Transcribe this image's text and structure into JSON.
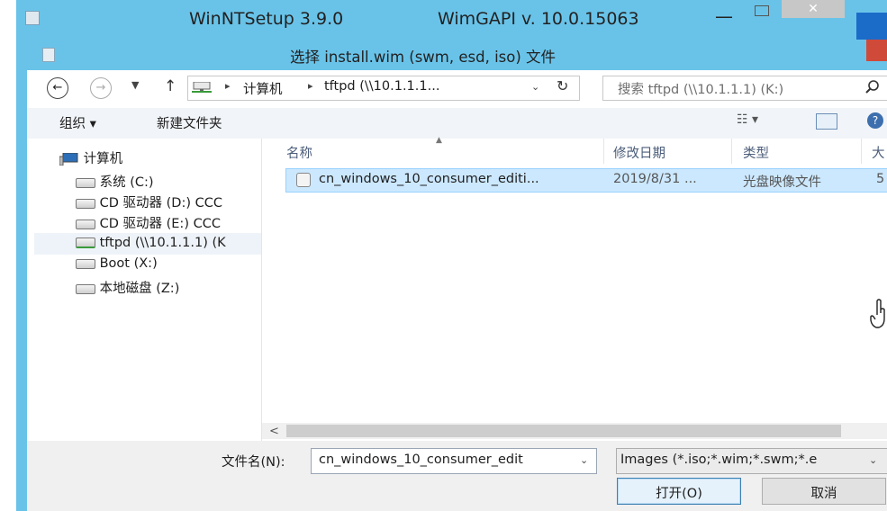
{
  "outer_window": {
    "title": "WinNTSetup 3.9.0",
    "gapi": "WimGAPI v. 10.0.15063",
    "minimize_glyph": "—",
    "close_glyph": "✕"
  },
  "dialog": {
    "title": "选择 install.wim (swm, esd, iso) 文件"
  },
  "nav": {
    "back_glyph": "←",
    "forward_glyph": "→",
    "history_glyph": "▼",
    "up_glyph": "↑",
    "breadcrumb_sep": "▸",
    "breadcrumb": [
      "计算机",
      "tftpd (\\\\10.1.1.1..."
    ],
    "address_dropdown_glyph": "⌄",
    "refresh_glyph": "↻",
    "search_placeholder": "搜索 tftpd (\\\\10.1.1.1) (K:)"
  },
  "toolbar": {
    "organize": "组织 ▾",
    "new_folder": "新建文件夹",
    "view": "☷ ▾",
    "help_glyph": "?"
  },
  "tree": {
    "computer": "计算机",
    "items": [
      "系统 (C:)",
      "CD 驱动器 (D:) CCC",
      "CD 驱动器 (E:) CCC",
      "tftpd (\\\\10.1.1.1) (K",
      "Boot (X:)",
      "本地磁盘 (Z:)"
    ]
  },
  "columns": {
    "name": "名称",
    "date": "修改日期",
    "type": "类型",
    "size": "大",
    "sort_glyph": "▲"
  },
  "files": [
    {
      "name": "cn_windows_10_consumer_editi...",
      "date": "2019/8/31 ...",
      "type": "光盘映像文件",
      "size": "5"
    }
  ],
  "scroll_left_glyph": "<",
  "bottom": {
    "filename_label": "文件名(N):",
    "filename_value": "cn_windows_10_consumer_edit",
    "filter_value": "Images (*.iso;*.wim;*.swm;*.e",
    "dropdown_glyph": "⌄",
    "open_label": "打开(O)",
    "cancel_label": "取消"
  },
  "colors": {
    "frame": "#69c3e9",
    "selection": "#cce8ff",
    "dialog_close": "#d04a3a"
  }
}
